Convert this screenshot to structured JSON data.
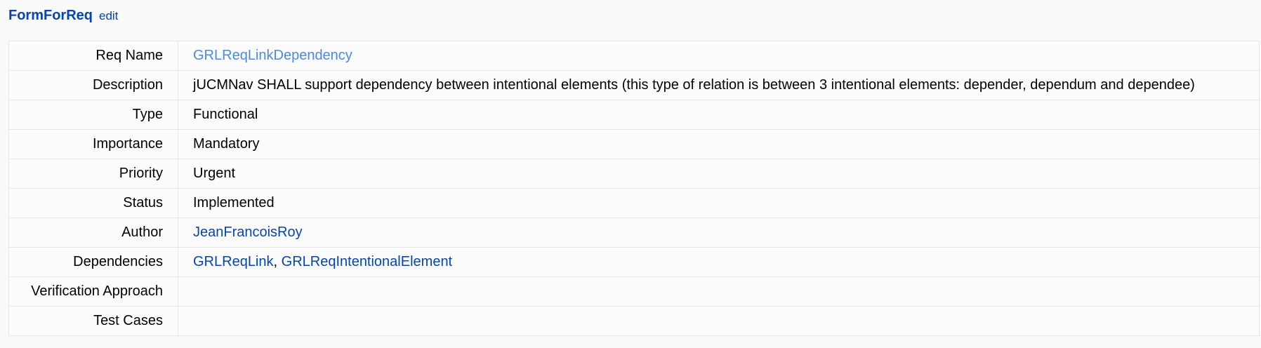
{
  "header": {
    "title": "FormForReq",
    "edit_label": "edit"
  },
  "fields": {
    "req_name": {
      "label": "Req Name",
      "value": "GRLReqLinkDependency"
    },
    "description": {
      "label": "Description",
      "value": "jUCMNav SHALL support dependency between intentional elements (this type of relation is between 3 intentional elements: depender, dependum and dependee)"
    },
    "type": {
      "label": "Type",
      "value": "Functional"
    },
    "importance": {
      "label": "Importance",
      "value": "Mandatory"
    },
    "priority": {
      "label": "Priority",
      "value": "Urgent"
    },
    "status": {
      "label": "Status",
      "value": "Implemented"
    },
    "author": {
      "label": "Author",
      "value": "JeanFrancoisRoy"
    },
    "dependencies": {
      "label": "Dependencies",
      "items": [
        "GRLReqLink",
        "GRLReqIntentionalElement"
      ],
      "separator": ", "
    },
    "verification_approach": {
      "label": "Verification Approach",
      "value": ""
    },
    "test_cases": {
      "label": "Test Cases",
      "value": ""
    }
  },
  "colors": {
    "link": "#0645ad",
    "visited_link": "#4a8ad8",
    "border": "#e6e6e6",
    "background": "#f9f9f9"
  }
}
